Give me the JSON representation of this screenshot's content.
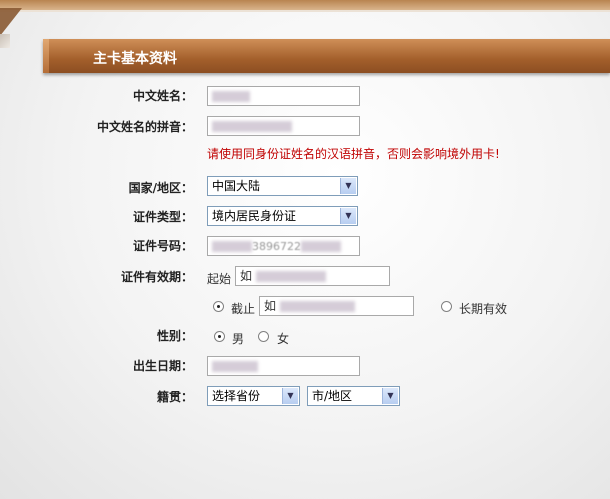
{
  "section": {
    "title": "主卡基本资料"
  },
  "labels": {
    "cn_name": "中文姓名：",
    "cn_pinyin": "中文姓名的拼音：",
    "country": "国家/地区：",
    "id_type": "证件类型：",
    "id_number": "证件号码：",
    "id_validity": "证件有效期：",
    "gender": "性别：",
    "birth_date": "出生日期：",
    "native_place": "籍贯："
  },
  "warning": "请使用同身份证姓名的汉语拼音，否则会影响境外用卡!",
  "fields": {
    "country": "中国大陆",
    "id_type": "境内居民身份证",
    "id_number_visible": "3896722",
    "start_prefix": "如",
    "end_prefix": "如"
  },
  "validity": {
    "start_label": "起始",
    "end_label": "截止",
    "long_term_label": "长期有效"
  },
  "gender": {
    "male": "男",
    "female": "女"
  },
  "native": {
    "province": "选择省份",
    "city": "市/地区"
  }
}
